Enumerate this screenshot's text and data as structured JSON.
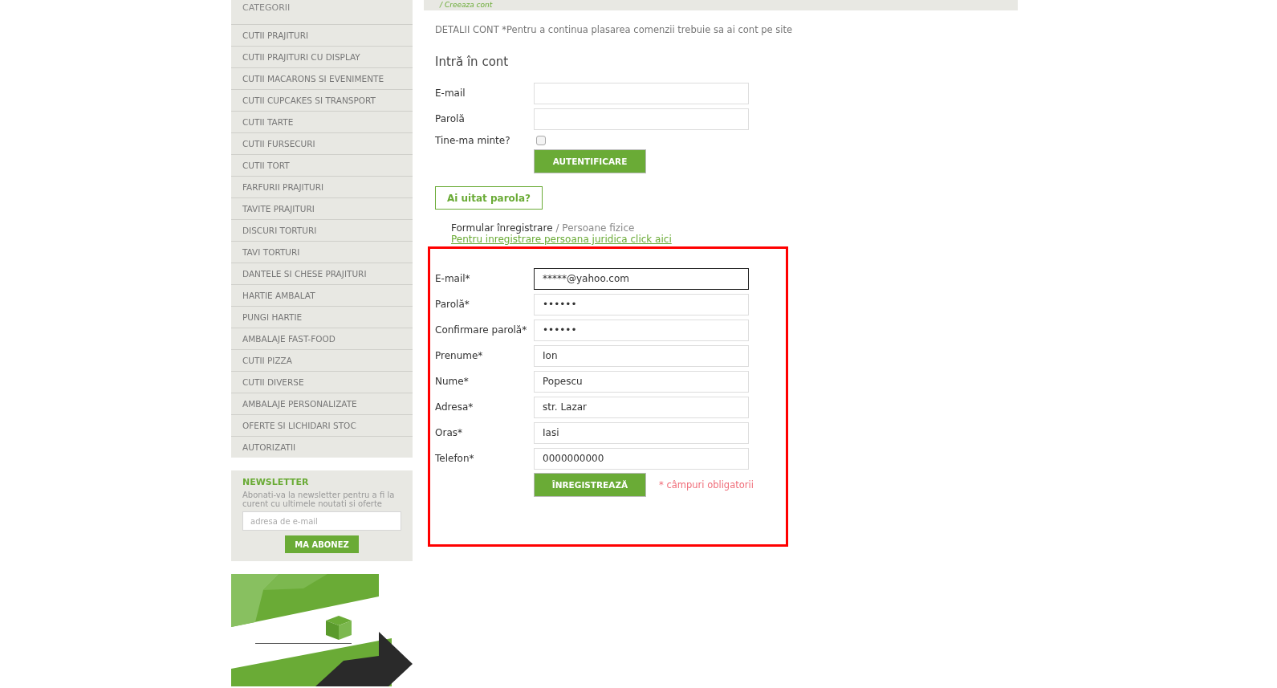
{
  "breadcrumb": "/ Creeaza cont",
  "sidebar": {
    "title": "CATEGORII",
    "items": [
      {
        "label": "CUTII PRAJITURI"
      },
      {
        "label": "CUTII PRAJITURI CU DISPLAY"
      },
      {
        "label": "CUTII MACARONS SI EVENIMENTE"
      },
      {
        "label": "CUTII CUPCAKES SI TRANSPORT"
      },
      {
        "label": "CUTII TARTE"
      },
      {
        "label": "CUTII FURSECURI"
      },
      {
        "label": "CUTII TORT"
      },
      {
        "label": "FARFURII PRAJITURI"
      },
      {
        "label": "TAVITE PRAJITURI"
      },
      {
        "label": "DISCURI TORTURI"
      },
      {
        "label": "TAVI TORTURI"
      },
      {
        "label": "DANTELE SI CHESE PRAJITURI"
      },
      {
        "label": "HARTIE AMBALAT"
      },
      {
        "label": "PUNGI HARTIE"
      },
      {
        "label": "AMBALAJE FAST-FOOD"
      },
      {
        "label": "CUTII PIZZA"
      },
      {
        "label": "CUTII DIVERSE"
      },
      {
        "label": "AMBALAJE PERSONALIZATE"
      },
      {
        "label": "OFERTE SI LICHIDARI STOC"
      },
      {
        "label": "AUTORIZATII"
      }
    ]
  },
  "newsletter": {
    "title": "NEWSLETTER",
    "text": "Abonati-va la newsletter pentru a fi la curent cu ultimele noutati si oferte",
    "placeholder": "adresa de e-mail",
    "button": "MA ABONEZ"
  },
  "intro": "DETALII CONT *Pentru a continua plasarea comenzii trebuie sa ai cont pe site",
  "login": {
    "title": "Intră în cont",
    "fields": [
      {
        "label": "E-mail"
      },
      {
        "label": "Parolă"
      }
    ],
    "remember": {
      "label": "Tine-ma minte?",
      "checked": false
    },
    "button": "AUTENTIFICARE",
    "forgot": "Ai uitat parola?"
  },
  "register": {
    "heading": "Formular înregistrare",
    "subheading": "/ Persoane fizice",
    "company_link": "Pentru inregistrare persoana juridica click aici",
    "highlighted": true,
    "fields": [
      {
        "label": "E-mail*",
        "value": "*****@yahoo.com",
        "focused": true
      },
      {
        "label": "Parolă*",
        "value": "••••••",
        "focused": false
      },
      {
        "label": "Confirmare parolă*",
        "value": "••••••",
        "focused": false
      },
      {
        "label": "Prenume*",
        "value": "Ion",
        "focused": false
      },
      {
        "label": "Nume*",
        "value": "Popescu",
        "focused": false
      },
      {
        "label": "Adresa*",
        "value": "str. Lazar",
        "focused": false
      },
      {
        "label": "Oras*",
        "value": "Iasi",
        "focused": false
      },
      {
        "label": "Telefon*",
        "value": "0000000000",
        "focused": false
      }
    ],
    "button": "ÎNREGISTREAZĂ",
    "required_note": "* câmpuri obligatorii"
  }
}
